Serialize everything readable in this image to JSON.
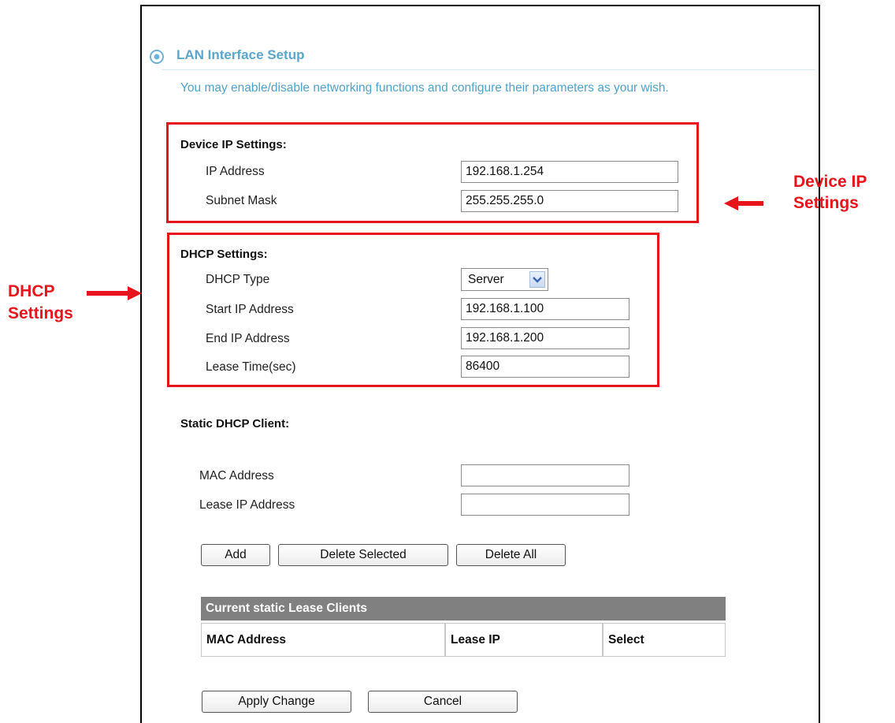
{
  "header": {
    "title": "LAN Interface Setup",
    "description": "You may enable/disable networking functions and configure their parameters as your wish."
  },
  "device_ip": {
    "section_title": "Device IP Settings:",
    "ip_label": "IP Address",
    "ip_value": "192.168.1.254",
    "mask_label": "Subnet Mask",
    "mask_value": "255.255.255.0"
  },
  "dhcp": {
    "section_title": "DHCP Settings:",
    "type_label": "DHCP Type",
    "type_value": "Server",
    "start_label": "Start IP Address",
    "start_value": "192.168.1.100",
    "end_label": "End IP Address",
    "end_value": "192.168.1.200",
    "lease_label": "Lease Time(sec)",
    "lease_value": "86400"
  },
  "static_client": {
    "section_title": "Static DHCP Client:",
    "mac_label": "MAC Address",
    "mac_value": "",
    "lease_ip_label": "Lease IP Address",
    "lease_ip_value": "",
    "add_label": "Add",
    "delete_selected_label": "Delete Selected",
    "delete_all_label": "Delete All"
  },
  "lease_table": {
    "title": "Current static Lease Clients",
    "columns": [
      "MAC Address",
      "Lease IP",
      "Select"
    ]
  },
  "actions": {
    "apply_label": "Apply Change",
    "cancel_label": "Cancel"
  },
  "annotations": {
    "device_ip_line1": "Device IP",
    "device_ip_line2": "Settings",
    "dhcp_line1": "DHCP",
    "dhcp_line2": "Settings",
    "color": "#e8141b"
  },
  "theme": {
    "title_color": "#5aa6cc",
    "table_header_bg": "#808080"
  }
}
